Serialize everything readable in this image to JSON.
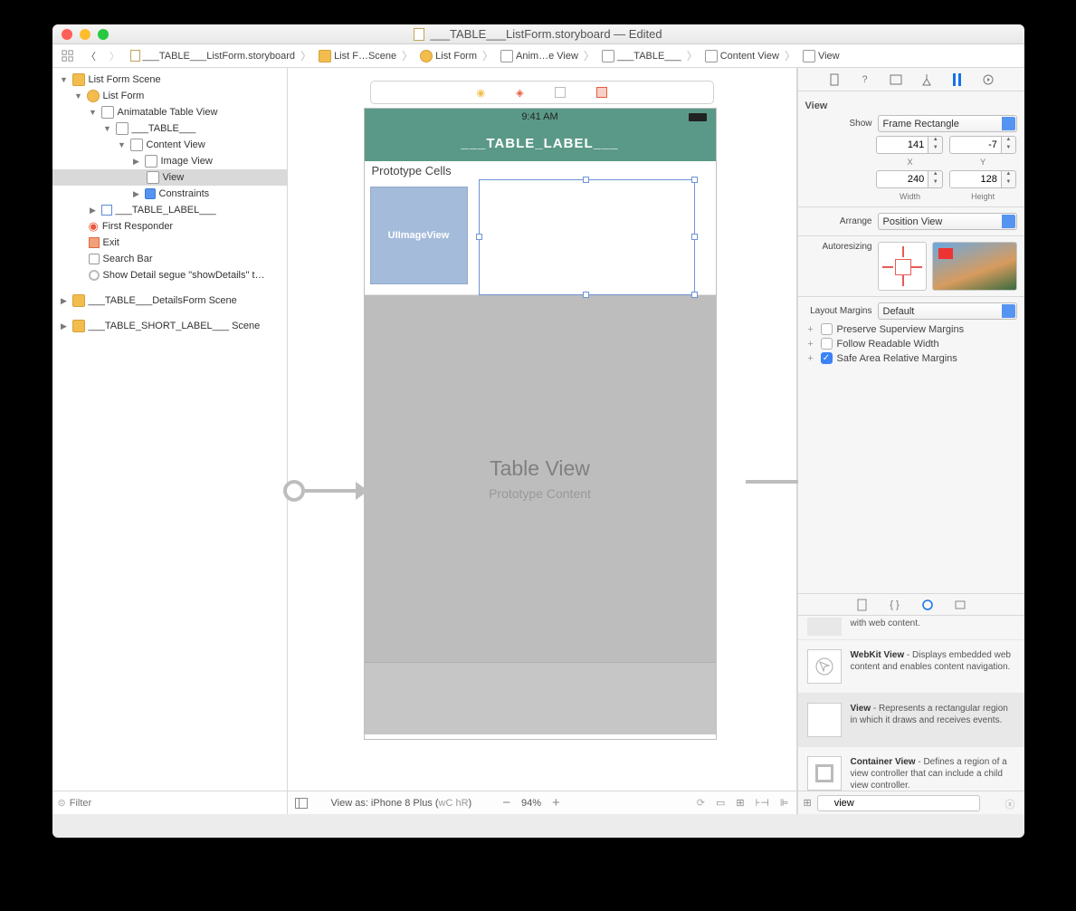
{
  "window": {
    "title": "___TABLE___ListForm.storyboard — Edited"
  },
  "breadcrumbs": [
    {
      "icon": "file",
      "label": "___TABLE___ListForm.storyboard"
    },
    {
      "icon": "yellow",
      "label": "List F…Scene"
    },
    {
      "icon": "yellow",
      "label": "List Form"
    },
    {
      "icon": "gray",
      "label": "Anim…e View"
    },
    {
      "icon": "gray",
      "label": "___TABLE___"
    },
    {
      "icon": "gray",
      "label": "Content View"
    },
    {
      "icon": "gray",
      "label": "View"
    }
  ],
  "outline": {
    "scene_root": "List Form Scene",
    "list_form": "List Form",
    "anim": "Animatable Table View",
    "table": "___TABLE___",
    "content": "Content View",
    "imgv": "Image View",
    "view": "View",
    "constraints": "Constraints",
    "table_label": "___TABLE_LABEL___",
    "first_responder": "First Responder",
    "exit": "Exit",
    "search_bar": "Search Bar",
    "segue": "Show Detail segue \"showDetails\" t…",
    "details_scene": "___TABLE___DetailsForm Scene",
    "short_scene": "___TABLE_SHORT_LABEL___ Scene",
    "filter_placeholder": "Filter"
  },
  "canvas": {
    "status_time": "9:41 AM",
    "nav_title": "___TABLE_LABEL___",
    "prototype_hdr": "Prototype Cells",
    "uiimageview": "UIImageView",
    "tv_title": "Table View",
    "tv_sub": "Prototype Content"
  },
  "bottom": {
    "view_as": "View as: iPhone 8 Plus (",
    "wc": "wC",
    "hr": "hR",
    "close": ")",
    "zoom": "94%"
  },
  "inspector": {
    "header": "View",
    "show_label": "Show",
    "show_value": "Frame Rectangle",
    "x": "141",
    "y": "-7",
    "x_lbl": "X",
    "y_lbl": "Y",
    "w": "240",
    "h": "128",
    "w_lbl": "Width",
    "h_lbl": "Height",
    "arrange_label": "Arrange",
    "arrange_value": "Position View",
    "autoresizing_label": "Autoresizing",
    "margins_label": "Layout Margins",
    "margins_value": "Default",
    "chk_preserve": "Preserve Superview Margins",
    "chk_readable": "Follow Readable Width",
    "chk_safe": "Safe Area Relative Margins"
  },
  "library": {
    "webkit_snip": "with web content.",
    "webkit_name": "WebKit View",
    "webkit_desc": " - Displays embedded web content and enables content navigation.",
    "view_name": "View",
    "view_desc": " - Represents a rectangular region in which it draws and receives events.",
    "container_name": "Container View",
    "container_desc": " - Defines a region of a view controller that can include a child view controller.",
    "filter": "view"
  }
}
